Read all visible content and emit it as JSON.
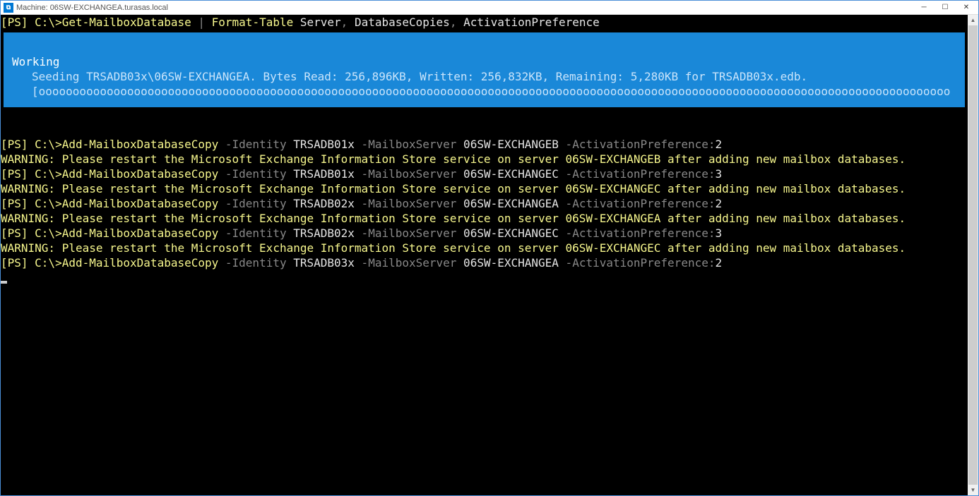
{
  "window": {
    "title": "Machine: 06SW-EXCHANGEA.turasas.local",
    "app_icon_text": "⧉"
  },
  "line1": {
    "prompt": "[PS] C:\\>",
    "cmd": "Get-MailboxDatabase",
    "pipe": " | ",
    "cmd2": "Format-Table",
    "args": " Server",
    "comma1": ",",
    "arg2": " DatabaseCopies",
    "comma2": ",",
    "arg3": " ActivationPreference"
  },
  "progress": {
    "title": "Working",
    "status": "Seeding TRSADB03x\\06SW-EXCHANGEA. Bytes Read: 256,896KB, Written: 256,832KB, Remaining: 5,280KB for TRSADB03x.edb.",
    "bar": "[oooooooooooooooooooooooooooooooooooooooooooooooooooooooooooooooooooooooooooooooooooooooooooooooooooooooooooooooooooooooooooooooooooooo    ]"
  },
  "cmds": [
    {
      "prompt": "[PS] C:\\>",
      "cmd": "Add-MailboxDatabaseCopy",
      "p1": " -Identity",
      "v1": " TRSADB01x",
      "p2": " -MailboxServer",
      "v2": " 06SW-EXCHANGEB",
      "p3": " -ActivationPreference:",
      "v3": "2",
      "warn": "WARNING: Please restart the Microsoft Exchange Information Store service on server 06SW-EXCHANGEB after adding new mailbox databases."
    },
    {
      "prompt": "[PS] C:\\>",
      "cmd": "Add-MailboxDatabaseCopy",
      "p1": " -Identity",
      "v1": " TRSADB01x",
      "p2": " -MailboxServer",
      "v2": " 06SW-EXCHANGEC",
      "p3": " -ActivationPreference:",
      "v3": "3",
      "warn": "WARNING: Please restart the Microsoft Exchange Information Store service on server 06SW-EXCHANGEC after adding new mailbox databases."
    },
    {
      "prompt": "[PS] C:\\>",
      "cmd": "Add-MailboxDatabaseCopy",
      "p1": " -Identity",
      "v1": " TRSADB02x",
      "p2": " -MailboxServer",
      "v2": " 06SW-EXCHANGEA",
      "p3": " -ActivationPreference:",
      "v3": "2",
      "warn": "WARNING: Please restart the Microsoft Exchange Information Store service on server 06SW-EXCHANGEA after adding new mailbox databases."
    },
    {
      "prompt": "[PS] C:\\>",
      "cmd": "Add-MailboxDatabaseCopy",
      "p1": " -Identity",
      "v1": " TRSADB02x",
      "p2": " -MailboxServer",
      "v2": " 06SW-EXCHANGEC",
      "p3": " -ActivationPreference:",
      "v3": "3",
      "warn": "WARNING: Please restart the Microsoft Exchange Information Store service on server 06SW-EXCHANGEC after adding new mailbox databases."
    },
    {
      "prompt": "[PS] C:\\>",
      "cmd": "Add-MailboxDatabaseCopy",
      "p1": " -Identity",
      "v1": " TRSADB03x",
      "p2": " -MailboxServer",
      "v2": " 06SW-EXCHANGEA",
      "p3": " -ActivationPreference:",
      "v3": "2",
      "warn": ""
    }
  ]
}
